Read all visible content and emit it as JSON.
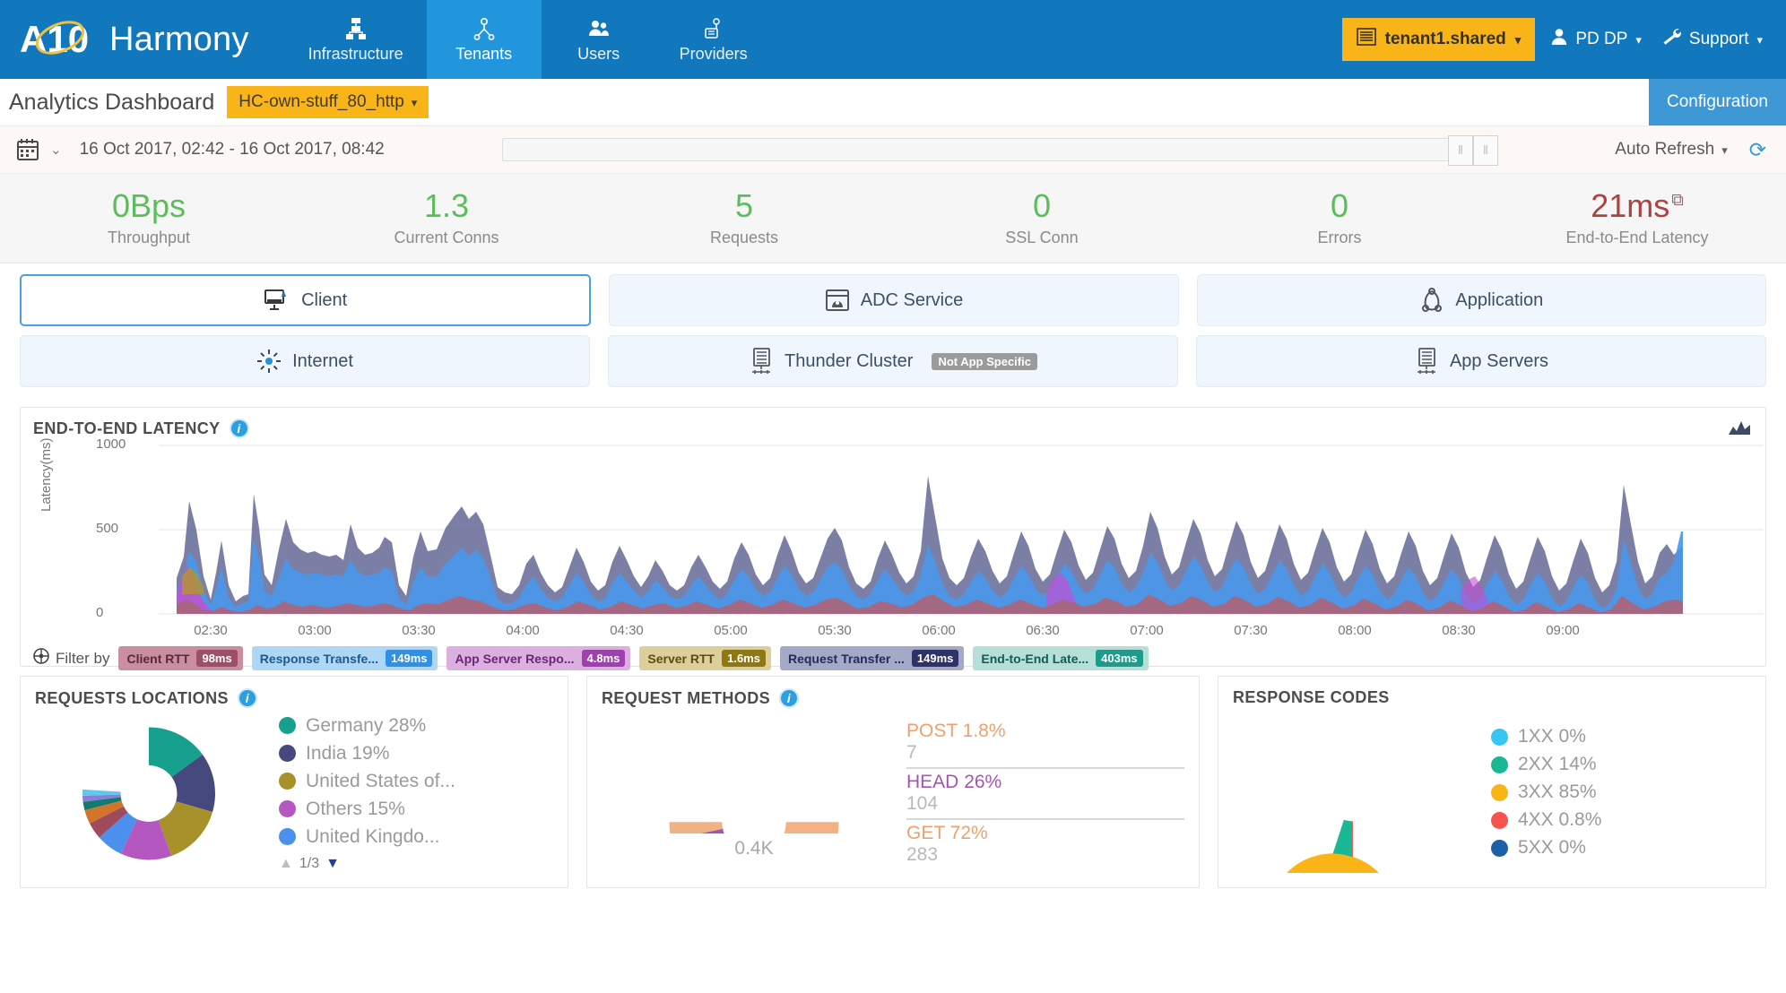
{
  "topnav": {
    "brand": "Harmony",
    "items": [
      {
        "label": "Infrastructure",
        "icon": "infrastructure-icon",
        "active": false
      },
      {
        "label": "Tenants",
        "icon": "tenants-icon",
        "active": true
      },
      {
        "label": "Users",
        "icon": "users-icon",
        "active": false
      },
      {
        "label": "Providers",
        "icon": "providers-icon",
        "active": false
      }
    ],
    "tenant": "tenant1.shared",
    "user": "PD DP",
    "support": "Support",
    "accent_blue": "#1278be",
    "accent_yellow": "#f9b518"
  },
  "subbar": {
    "title": "Analytics Dashboard",
    "app": "HC-own-stuff_80_http",
    "configuration": "Configuration"
  },
  "datebar": {
    "range": "16 Oct 2017, 02:42 - 16 Oct 2017, 08:42",
    "auto_refresh": "Auto Refresh"
  },
  "kpis": [
    {
      "value": "0Bps",
      "label": "Throughput",
      "color": "green"
    },
    {
      "value": "1.3",
      "label": "Current Conns",
      "color": "green"
    },
    {
      "value": "5",
      "label": "Requests",
      "color": "green"
    },
    {
      "value": "0",
      "label": "SSL Conn",
      "color": "green"
    },
    {
      "value": "0",
      "label": "Errors",
      "color": "green"
    },
    {
      "value": "21ms",
      "label": "End-to-End Latency",
      "color": "red"
    }
  ],
  "tiles": [
    {
      "label": "Client",
      "icon": "client-monitor-icon",
      "selected": true,
      "badge": ""
    },
    {
      "label": "ADC Service",
      "icon": "adc-service-icon",
      "selected": false,
      "badge": ""
    },
    {
      "label": "Application",
      "icon": "application-graph-icon",
      "selected": false,
      "badge": ""
    },
    {
      "label": "Internet",
      "icon": "internet-icon",
      "selected": false,
      "badge": ""
    },
    {
      "label": "Thunder Cluster",
      "icon": "thunder-cluster-icon",
      "selected": false,
      "badge": "Not App Specific"
    },
    {
      "label": "App Servers",
      "icon": "app-servers-icon",
      "selected": false,
      "badge": ""
    }
  ],
  "latency_panel": {
    "title": "END-TO-END LATENCY",
    "filter_label": "Filter by",
    "chips": [
      {
        "name": "Client RTT",
        "value": "98ms",
        "bg": "#c98ea0",
        "vbg": "#9e4f68"
      },
      {
        "name": "Response Transfe...",
        "value": "149ms",
        "bg": "#aed6f5",
        "vbg": "#2e90e8"
      },
      {
        "name": "App Server Respo...",
        "value": "4.8ms",
        "bg": "#ddafe0",
        "vbg": "#a13fb0"
      },
      {
        "name": "Server RTT",
        "value": "1.6ms",
        "bg": "#ddcf9c",
        "vbg": "#8f7712"
      },
      {
        "name": "Request Transfer ...",
        "value": "149ms",
        "bg": "#a5a9c8",
        "vbg": "#2f3268"
      },
      {
        "name": "End-to-End Late...",
        "value": "403ms",
        "bg": "#b6e0d7",
        "vbg": "#1b9c8c"
      }
    ]
  },
  "chart_data": [
    {
      "type": "area",
      "title": "END-TO-END LATENCY",
      "xlabel": "",
      "ylabel": "Latency(ms)",
      "ylim": [
        0,
        1000
      ],
      "yticks": [
        0,
        500,
        1000
      ],
      "grid": true,
      "legend_position": "bottom",
      "x": [
        "02:30",
        "03:00",
        "03:30",
        "04:00",
        "04:30",
        "05:00",
        "05:30",
        "06:00",
        "06:30",
        "07:00",
        "07:30",
        "08:00",
        "08:30",
        "09:00"
      ],
      "series": [
        {
          "name": "Client RTT",
          "color": "#a9657d",
          "latest": "98ms"
        },
        {
          "name": "Response Transfer Time",
          "color": "#4a97ec",
          "latest": "149ms"
        },
        {
          "name": "App Server Response Time",
          "color": "#c44fd4",
          "latest": "4.8ms"
        },
        {
          "name": "Server RTT",
          "color": "#b4952a",
          "latest": "1.6ms"
        },
        {
          "name": "Request Transfer Time",
          "color": "#5e6391",
          "latest": "149ms"
        },
        {
          "name": "End-to-End Latency",
          "color": "#1b9c8c",
          "latest": "403ms"
        }
      ]
    },
    {
      "type": "pie",
      "title": "REQUESTS LOCATIONS",
      "labels": [
        "Germany",
        "India",
        "United States of...",
        "Others",
        "United Kingdo..."
      ],
      "values": [
        28,
        19,
        20,
        15,
        7
      ],
      "display": [
        "Germany 28%",
        "India 19%",
        "United States of...",
        "Others 15%",
        "United Kingdo..."
      ],
      "colors": [
        "#18a08f",
        "#46497e",
        "#a8902b",
        "#b457c0",
        "#4a90ec"
      ],
      "page": "1/3",
      "legend_position": "right"
    },
    {
      "type": "pie",
      "title": "REQUEST METHODS",
      "subtype": "half-donut-gauge",
      "total_label": "0.4K",
      "labels": [
        "POST",
        "HEAD",
        "GET"
      ],
      "percents": [
        "1.8%",
        "26%",
        "72%"
      ],
      "counts": [
        "7",
        "104",
        "283"
      ],
      "values": [
        1.8,
        26,
        72
      ],
      "colors": [
        "#f0b183",
        "#a355b5",
        "#f4b183"
      ],
      "legend_position": "right"
    },
    {
      "type": "pie",
      "title": "RESPONSE CODES",
      "labels": [
        "1XX",
        "2XX",
        "3XX",
        "4XX",
        "5XX"
      ],
      "display": [
        "1XX 0%",
        "2XX 14%",
        "3XX 85%",
        "4XX 0.8%",
        "5XX 0%"
      ],
      "values": [
        0,
        14,
        85,
        0.8,
        0
      ],
      "colors": [
        "#35c6f4",
        "#18b894",
        "#fbb417",
        "#f8544f",
        "#1e5fa8"
      ],
      "legend_position": "right"
    }
  ],
  "panels": {
    "locations_title": "REQUESTS LOCATIONS",
    "methods_title": "REQUEST METHODS",
    "codes_title": "RESPONSE CODES"
  }
}
